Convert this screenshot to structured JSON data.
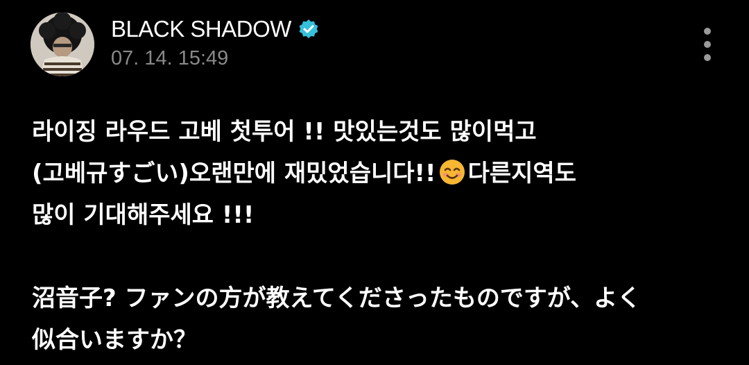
{
  "post": {
    "author": {
      "name": "BLACK SHADOW",
      "verified": true,
      "avatar_icon": "profile-photo-curly-hair"
    },
    "timestamp": "07. 14. 15:49",
    "more_icon": "vertical-ellipsis-icon",
    "body": {
      "line1": "라이징 라우드 고베 첫투어 !! 맛있는것도 많이먹고",
      "line2_before_emoji": "(고베규すごい)오랜만에 재밌었습니다!!",
      "emoji": "smiling-face-icon",
      "line2_after_emoji": "다른지역도",
      "line3": "많이 기대해주세요 !!!",
      "line4": "沼音子? ファンの方が教えてくださったものですが、よく",
      "line5": "似合いますか？"
    }
  },
  "colors": {
    "background": "#000000",
    "text": "#ffffff",
    "muted": "#8a8a8a",
    "verified_badge": "#35c0dc",
    "emoji": "#f7b733"
  }
}
